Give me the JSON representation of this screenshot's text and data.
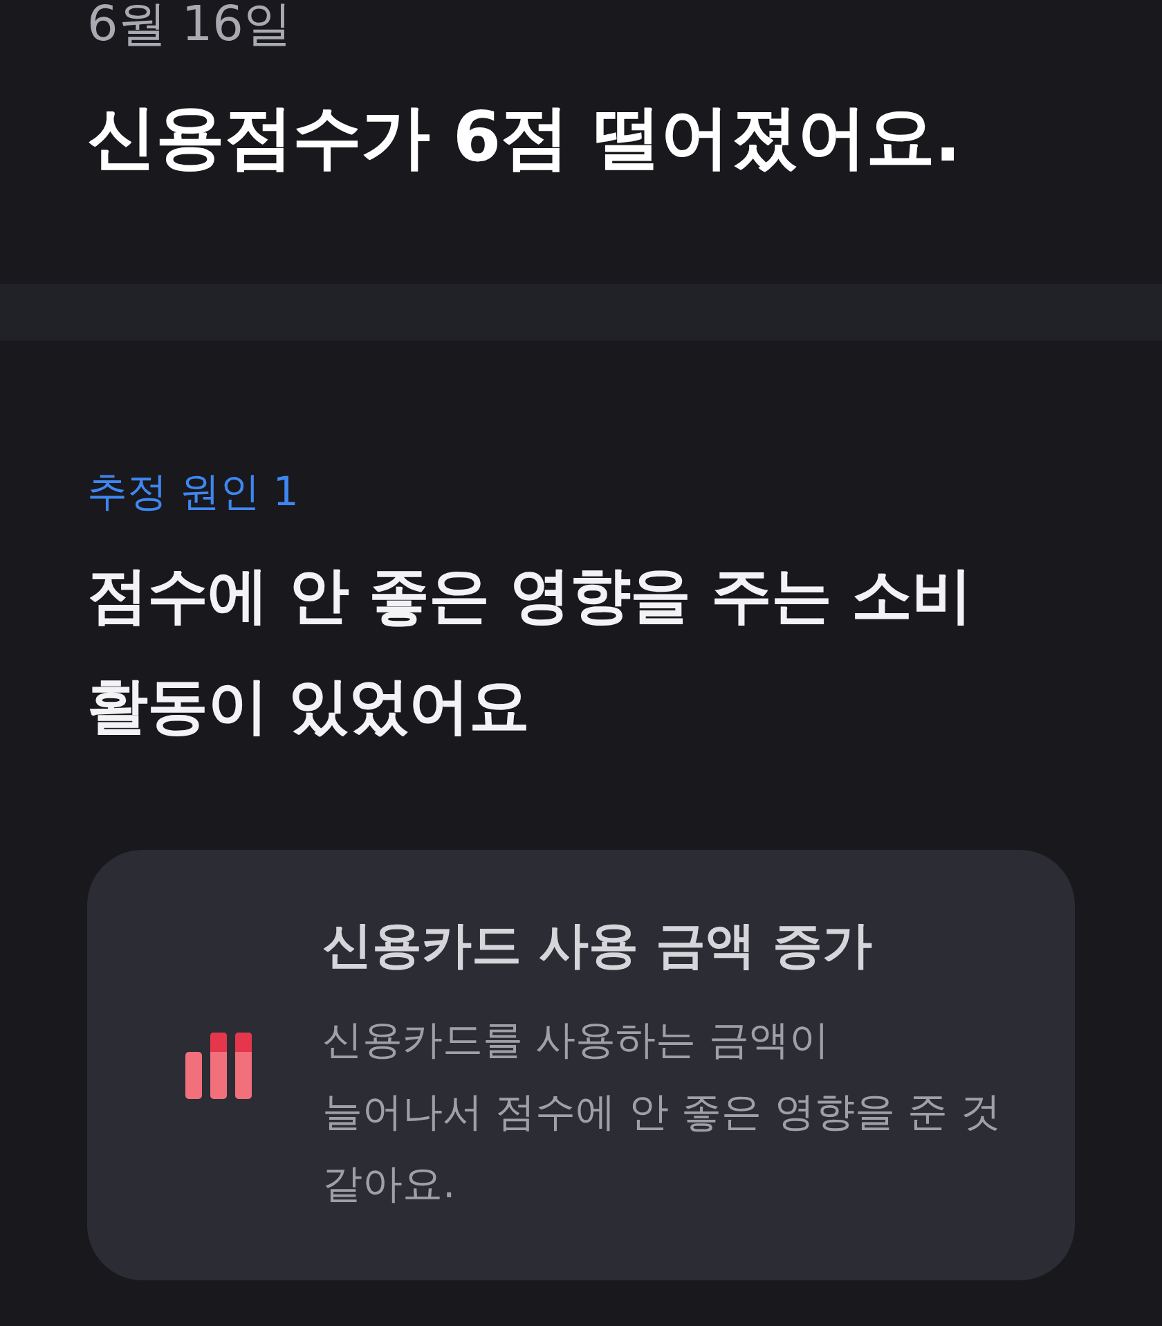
{
  "header": {
    "date": "6월 16일",
    "title": "신용점수가 6점 떨어졌어요."
  },
  "cause": {
    "label": "추정 원인 1",
    "heading_lines": [
      "점수에 안 좋은 영향을 주는 소비",
      "활동이 있었어요"
    ],
    "card": {
      "title": "신용카드 사용 금액 증가",
      "description_lines": [
        "신용카드를 사용하는 금액이",
        "늘어나서 점수에 안 좋은 영향을 준 것",
        "같아요."
      ]
    }
  }
}
